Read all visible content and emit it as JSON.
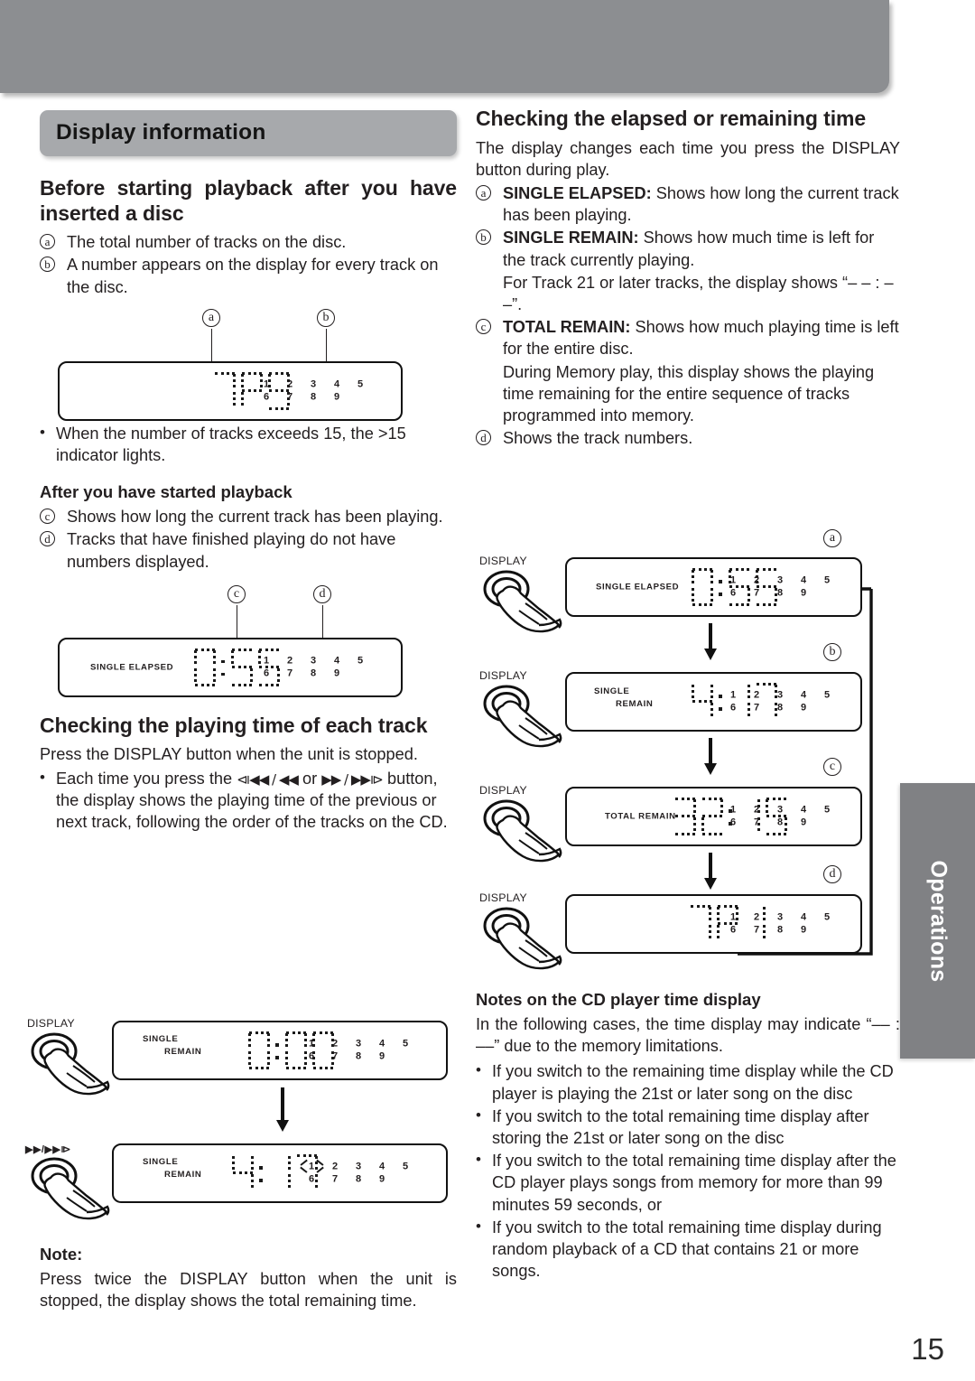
{
  "page": {
    "number": "15",
    "side_tab": "Operations"
  },
  "left": {
    "section_title": "Display information",
    "before_playback": {
      "heading": "Before starting playback after you have inserted a disc",
      "items": [
        {
          "mark": "a",
          "text": "The total number of tracks on the disc."
        },
        {
          "mark": "b",
          "text": "A number appears on the display for every track on the disc."
        }
      ],
      "callouts": [
        "a",
        "b"
      ],
      "display": {
        "mode": "",
        "digits": "TR9",
        "tracks_row1": [
          "1",
          "2",
          "3",
          "4",
          "5"
        ],
        "tracks_row2": [
          "6",
          "7",
          "8",
          "9",
          ""
        ]
      },
      "note_bullet": "When the number of tracks exceeds 15, the >15 indicator lights."
    },
    "after_playback": {
      "heading": "After you have started playback",
      "items": [
        {
          "mark": "c",
          "text": "Shows how long the current track has been playing."
        },
        {
          "mark": "d",
          "text": "Tracks that have finished playing do not have numbers displayed."
        }
      ],
      "callouts": [
        "c",
        "d"
      ],
      "display": {
        "mode": "SINGLE  ELAPSED",
        "digits": "0:55",
        "tracks_row1": [
          "1",
          "2",
          "3",
          "4",
          "5"
        ],
        "tracks_row2": [
          "6",
          "7",
          "8",
          "9",
          ""
        ]
      }
    },
    "playing_time": {
      "heading": "Checking the playing time of each track",
      "intro": "Press the DISPLAY button when the unit is stopped.",
      "bullet_pre": "Each time you press the ",
      "bullet_icon_1": "⧏◀◀ / ◀◀",
      "bullet_mid": " or ",
      "bullet_icon_2": "▶▶ / ▶▶⧐",
      "bullet_post": " button, the display shows the playing time of the previous or next track, following the order of the tracks on the CD.",
      "steps": [
        {
          "button_label": "DISPLAY",
          "button_type": "display",
          "mode_line1": "SINGLE",
          "mode_line2": "REMAIN",
          "digits": "0:00",
          "tracks_row1": [
            "1",
            "2",
            "3",
            "4",
            "5"
          ],
          "tracks_row2": [
            "6",
            "7",
            "8",
            "9",
            ""
          ],
          "blink_track": ""
        },
        {
          "button_label": "▶▶/▶▶⧐",
          "button_type": "skip",
          "mode_line1": "SINGLE",
          "mode_line2": "REMAIN",
          "digits": "4:17",
          "tracks_row1": [
            "1",
            "2",
            "3",
            "4",
            "5"
          ],
          "tracks_row2": [
            "6",
            "7",
            "8",
            "9",
            ""
          ],
          "blink_track": "1"
        }
      ],
      "note_label": "Note:",
      "note_text": "Press twice the DISPLAY button when the unit is stopped, the display shows the total remaining time."
    }
  },
  "right": {
    "elapsed_remaining": {
      "heading": "Checking the elapsed or remaining time",
      "intro": "The display changes each time you press the DISPLAY button during play.",
      "items": [
        {
          "mark": "a",
          "label": "SINGLE ELAPSED:",
          "text": " Shows how long the current track has been playing."
        },
        {
          "mark": "b",
          "label": "SINGLE REMAIN:",
          "text": " Shows how much time is left for the track currently playing."
        },
        {
          "mark": "",
          "label": "",
          "text": "For Track 21 or later tracks, the display shows “– – : – –”."
        },
        {
          "mark": "c",
          "label": "TOTAL REMAIN:",
          "text": " Shows how much playing time is left for the entire disc."
        },
        {
          "mark": "",
          "label": "",
          "text": "During Memory play, this display shows the playing time remaining for the entire sequence of tracks programmed into memory."
        },
        {
          "mark": "d",
          "label": "",
          "text": "Shows the track numbers."
        }
      ],
      "steps": [
        {
          "callout": "a",
          "button_label": "DISPLAY",
          "mode": "SINGLE  ELAPSED",
          "mode_line1": "",
          "mode_line2": "",
          "digits": "0:55",
          "tracks_row1": [
            "1",
            "2",
            "3",
            "4",
            "5"
          ],
          "tracks_row2": [
            "6",
            "7",
            "8",
            "9",
            ""
          ]
        },
        {
          "callout": "b",
          "button_label": "DISPLAY",
          "mode": "",
          "mode_line1": "SINGLE",
          "mode_line2": "REMAIN",
          "digits": "4:17",
          "tracks_row1": [
            "1",
            "2",
            "3",
            "4",
            "5"
          ],
          "tracks_row2": [
            "6",
            "7",
            "8",
            "9",
            ""
          ]
        },
        {
          "callout": "c",
          "button_label": "DISPLAY",
          "mode": "TOTAL  REMAIN",
          "mode_line1": "",
          "mode_line2": "",
          "digits": "32:15",
          "tracks_row1": [
            "1",
            "2",
            "3",
            "4",
            "5"
          ],
          "tracks_row2": [
            "6",
            "7",
            "8",
            "9",
            ""
          ]
        },
        {
          "callout": "d",
          "button_label": "DISPLAY",
          "mode": "",
          "mode_line1": "",
          "mode_line2": "",
          "digits": "TR1",
          "tracks_row1": [
            "1",
            "2",
            "3",
            "4",
            "5"
          ],
          "tracks_row2": [
            "6",
            "7",
            "8",
            "9",
            ""
          ]
        }
      ]
    },
    "notes": {
      "heading": "Notes on the CD player time display",
      "intro": "In the following cases, the time display may indicate “–– : ––” due to the memory limitations.",
      "bullets": [
        "If you switch to the remaining time display while the CD player is playing the 21st or later song on the disc",
        "If you switch to the total remaining time display after storing the 21st or later song on the disc",
        "If you switch to the total remaining time display after the CD player plays songs from memory for more than 99 minutes 59 seconds, or",
        "If you switch to the total remaining time display during random playback of a CD that contains 21 or more songs."
      ]
    }
  }
}
